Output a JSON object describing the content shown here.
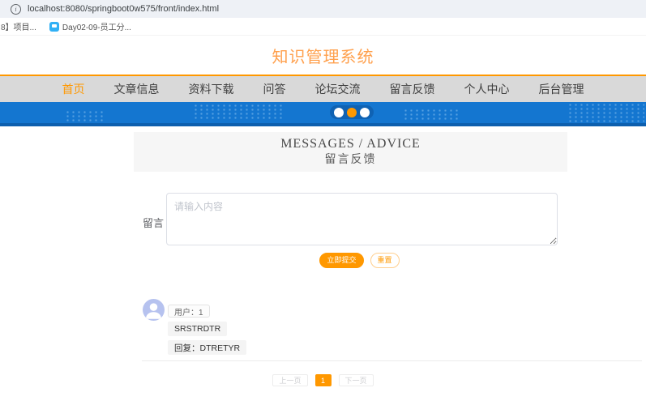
{
  "browser": {
    "url": "localhost:8080/springboot0w575/front/index.html",
    "bookmarks": [
      {
        "label": "8】项目..."
      },
      {
        "label": "Day02-09-员工分..."
      }
    ]
  },
  "site": {
    "title": "知识管理系统",
    "nav": [
      {
        "label": "首页",
        "active": true
      },
      {
        "label": "文章信息",
        "active": false
      },
      {
        "label": "资料下载",
        "active": false
      },
      {
        "label": "问答",
        "active": false
      },
      {
        "label": "论坛交流",
        "active": false
      },
      {
        "label": "留言反馈",
        "active": false
      },
      {
        "label": "个人中心",
        "active": false
      },
      {
        "label": "后台管理",
        "active": false
      }
    ],
    "carousel": {
      "dot_count": 3,
      "active_index": 1
    }
  },
  "section": {
    "title_en": "MESSAGES / ADVICE",
    "title_cn": "留言反馈"
  },
  "form": {
    "label": "留言",
    "placeholder": "请输入内容",
    "submit_label": "立即提交",
    "reset_label": "重置"
  },
  "messages": [
    {
      "user_tag": "用户：1",
      "content": "SRSTRDTR",
      "reply": "回复：DTRETYR"
    }
  ],
  "pagination": {
    "prev": "上一页",
    "current": "1",
    "next": "下一页"
  },
  "colors": {
    "accent_orange": "#ff9800",
    "title_orange": "#ffa04d",
    "banner_blue": "#1476d0",
    "banner_blue_dark": "#0d5fae",
    "nav_gray": "#d9d9d9"
  }
}
